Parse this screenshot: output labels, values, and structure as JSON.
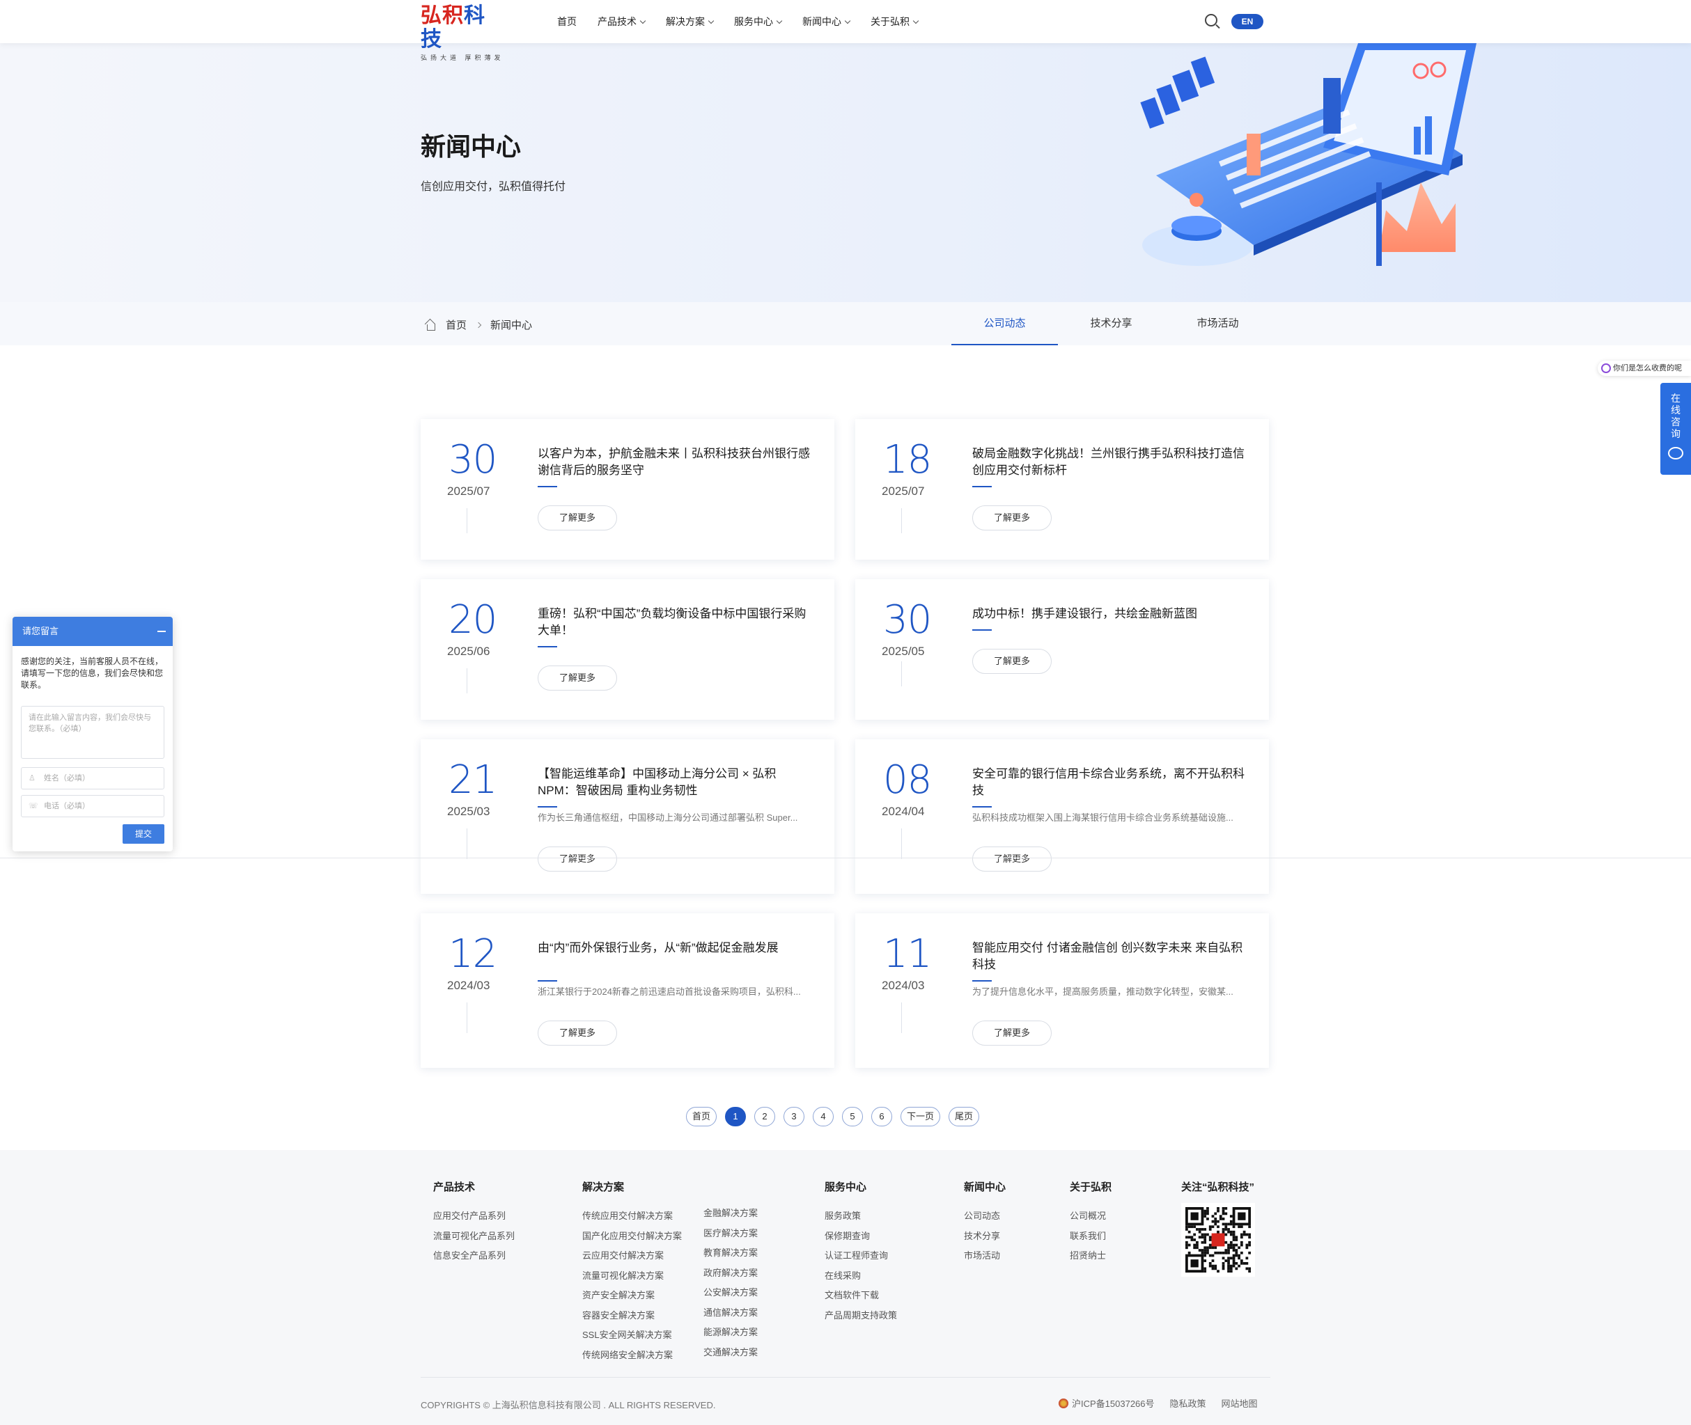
{
  "header": {
    "logo": {
      "part1": "弘积",
      "part2": "科技",
      "slogan": "弘扬大道 厚积薄发"
    },
    "nav": [
      {
        "label": "首页",
        "has_dropdown": false
      },
      {
        "label": "产品技术",
        "has_dropdown": true
      },
      {
        "label": "解决方案",
        "has_dropdown": true
      },
      {
        "label": "服务中心",
        "has_dropdown": true
      },
      {
        "label": "新闻中心",
        "has_dropdown": true
      },
      {
        "label": "关于弘积",
        "has_dropdown": true
      }
    ],
    "lang": "EN"
  },
  "banner": {
    "title": "新闻中心",
    "subtitle": "信创应用交付，弘积值得托付"
  },
  "breadcrumb": {
    "home": "首页",
    "current": "新闻中心"
  },
  "tabs": [
    {
      "label": "公司动态",
      "active": true
    },
    {
      "label": "技术分享",
      "active": false
    },
    {
      "label": "市场活动",
      "active": false
    }
  ],
  "more_label": "了解更多",
  "news": [
    {
      "day": "30",
      "ym": "2025/07",
      "title": "以客户为本，护航金融未来丨弘积科技获台州银行感谢信背后的服务坚守",
      "desc": ""
    },
    {
      "day": "18",
      "ym": "2025/07",
      "title": "破局金融数字化挑战！兰州银行携手弘积科技打造信创应用交付新标杆",
      "desc": ""
    },
    {
      "day": "20",
      "ym": "2025/06",
      "title": "重磅！弘积“中国芯”负载均衡设备中标中国银行采购大单！",
      "desc": ""
    },
    {
      "day": "30",
      "ym": "2025/05",
      "title": "成功中标！携手建设银行，共绘金融新蓝图",
      "desc": ""
    },
    {
      "day": "21",
      "ym": "2025/03",
      "title": "【智能运维革命】中国移动上海分公司 × 弘积NPM：智破困局 重构业务韧性",
      "desc": "作为长三角通信枢纽，中国移动上海分公司通过部署弘积 Super..."
    },
    {
      "day": "08",
      "ym": "2024/04",
      "title": "安全可靠的银行信用卡综合业务系统，离不开弘积科技",
      "desc": "弘积科技成功框架入围上海某银行信用卡综合业务系统基础设施..."
    },
    {
      "day": "12",
      "ym": "2024/03",
      "title": "由“内”而外保银行业务，从“新”做起促金融发展",
      "desc": "浙江某银行于2024新春之前迅速启动首批设备采购项目，弘积科..."
    },
    {
      "day": "11",
      "ym": "2024/03",
      "title": "智能应用交付 付诸金融信创 创兴数字未来 来自弘积科技",
      "desc": "为了提升信息化水平，提高服务质量，推动数字化转型，安徽某..."
    }
  ],
  "pagination": {
    "first": "首页",
    "pages": [
      "1",
      "2",
      "3",
      "4",
      "5",
      "6"
    ],
    "current": "1",
    "next": "下一页",
    "last": "尾页"
  },
  "footer": {
    "columns": [
      {
        "title": "产品技术",
        "links": [
          "应用交付产品系列",
          "流量可视化产品系列",
          "信息安全产品系列"
        ]
      },
      {
        "title": "解决方案",
        "links": [
          "传统应用交付解决方案",
          "国产化应用交付解决方案",
          "云应用交付解决方案",
          "流量可视化解决方案",
          "资产安全解决方案",
          "容器安全解决方案",
          "SSL安全网关解决方案",
          "传统网络安全解决方案"
        ]
      },
      {
        "title": "",
        "links": [
          "金融解决方案",
          "医疗解决方案",
          "教育解决方案",
          "政府解决方案",
          "公安解决方案",
          "通信解决方案",
          "能源解决方案",
          "交通解决方案"
        ]
      },
      {
        "title": "服务中心",
        "links": [
          "服务政策",
          "保修期查询",
          "认证工程师查询",
          "在线采购",
          "文档软件下载",
          "产品周期支持政策"
        ]
      },
      {
        "title": "新闻中心",
        "links": [
          "公司动态",
          "技术分享",
          "市场活动"
        ]
      },
      {
        "title": "关于弘积",
        "links": [
          "公司概况",
          "联系我们",
          "招贤纳士"
        ]
      }
    ],
    "follow_title": "关注“弘积科技”",
    "copyright": "COPYRIGHTS © 上海弘积信息科技有限公司 . ALL RIGHTS RESERVED.",
    "icp": "沪ICP备15037266号",
    "privacy": "隐私政策",
    "sitemap": "网站地图"
  },
  "chat": {
    "title": "请您留言",
    "message": "感谢您的关注，当前客服人员不在线，请填写一下您的信息，我们会尽快和您联系。",
    "content_placeholder": "请在此输入留言内容，我们会尽快与您联系。（必填）",
    "name_placeholder": "姓名（必填）",
    "phone_placeholder": "电话（必填）",
    "submit": "提交"
  },
  "side": {
    "tip": "你们是怎么收费的呢",
    "online": "在线咨询"
  },
  "colors": {
    "primary": "#1f56c4",
    "chat_blue": "#3e7de0",
    "logo_red": "#d7261f"
  }
}
